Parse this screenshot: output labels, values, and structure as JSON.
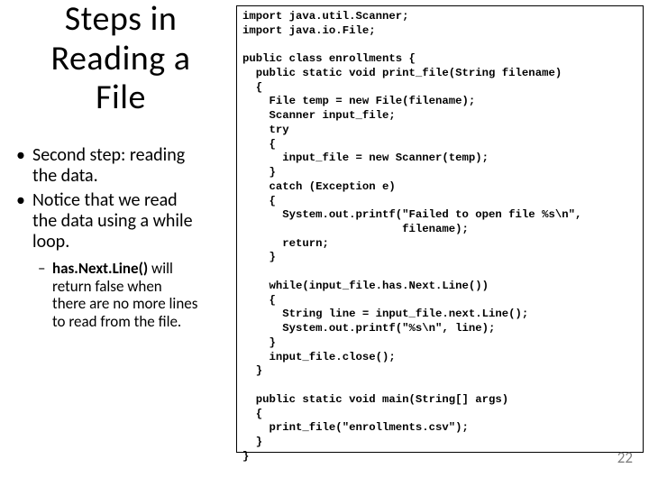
{
  "title_l1": "Steps in",
  "title_l2": "Reading a",
  "title_l3": "File",
  "bullet1a": "Second step: reading",
  "bullet1b": "the data.",
  "bullet2a": "Notice that we read",
  "bullet2b": "the data using a while",
  "bullet2c": "loop.",
  "sub_bold": "has.Next.Line()",
  "sub_rest1": " will",
  "sub_line2": "return false when",
  "sub_line3": "there are no more lines",
  "sub_line4": "to read from the file.",
  "code": "import java.util.Scanner;\nimport java.io.File;\n\npublic class enrollments {\n  public static void print_file(String filename)\n  {\n    File temp = new File(filename);\n    Scanner input_file;\n    try\n    {\n      input_file = new Scanner(temp);\n    }\n    catch (Exception e)\n    {\n      System.out.printf(\"Failed to open file %s\\n\",\n                        filename);\n      return;\n    }\n\n    while(input_file.has.Next.Line())\n    {\n      String line = input_file.next.Line();\n      System.out.printf(\"%s\\n\", line);\n    }\n    input_file.close();\n  }\n\n  public static void main(String[] args)\n  {\n    print_file(\"enrollments.csv\");\n  }\n}",
  "page_number": "22"
}
